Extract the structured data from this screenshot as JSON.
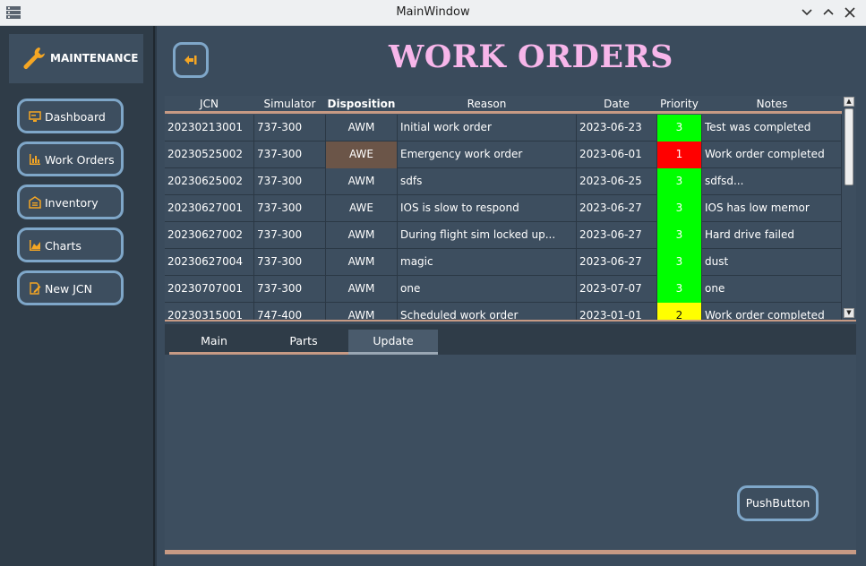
{
  "window": {
    "title": "MainWindow"
  },
  "sidebar": {
    "brand": "MAINTENANCE",
    "items": [
      {
        "label": "Dashboard",
        "icon": "monitor-icon"
      },
      {
        "label": "Work Orders",
        "icon": "bar-chart-icon"
      },
      {
        "label": "Inventory",
        "icon": "warehouse-icon"
      },
      {
        "label": "Charts",
        "icon": "area-chart-icon"
      },
      {
        "label": "New JCN",
        "icon": "edit-doc-icon"
      }
    ]
  },
  "header": {
    "title": "WORK ORDERS"
  },
  "table": {
    "columns": [
      "JCN",
      "Simulator",
      "Disposition",
      "Reason",
      "Date",
      "Priority",
      "Notes"
    ],
    "rows": [
      [
        "20230213001",
        "737-300",
        "AWM",
        "Initial work order",
        "2023-06-23",
        "3",
        "Test was completed"
      ],
      [
        "20230525002",
        "737-300",
        "AWE",
        "Emergency work order",
        "2023-06-01",
        "1",
        "Work order completed"
      ],
      [
        "20230625002",
        "737-300",
        "AWM",
        "sdfs",
        "2023-06-25",
        "3",
        "sdfsd..."
      ],
      [
        "20230627001",
        "737-300",
        "AWE",
        "IOS is slow to respond",
        "2023-06-27",
        "3",
        "IOS has low memor"
      ],
      [
        "20230627002",
        "737-300",
        "AWM",
        "During flight sim locked up...",
        "2023-06-27",
        "3",
        "Hard drive failed"
      ],
      [
        "20230627004",
        "737-300",
        "AWM",
        "magic",
        "2023-06-27",
        "3",
        "dust"
      ],
      [
        "20230707001",
        "737-300",
        "AWM",
        "one",
        "2023-07-07",
        "3",
        "one"
      ],
      [
        "20230315001",
        "747-400",
        "AWM",
        "Scheduled work order",
        "2023-01-01",
        "2",
        "Work order completed"
      ]
    ]
  },
  "tabs": [
    {
      "label": "Main"
    },
    {
      "label": "Parts"
    },
    {
      "label": "Update"
    }
  ],
  "panel": {
    "button_label": "PushButton"
  },
  "colors": {
    "priority_1": "#ff0000",
    "priority_2": "#ffff00",
    "priority_3": "#00ff00",
    "awe_highlight": "#6b5548",
    "title": "#f7b6ea",
    "accent_border": "#7fa7c9",
    "divider": "#c79a84"
  }
}
